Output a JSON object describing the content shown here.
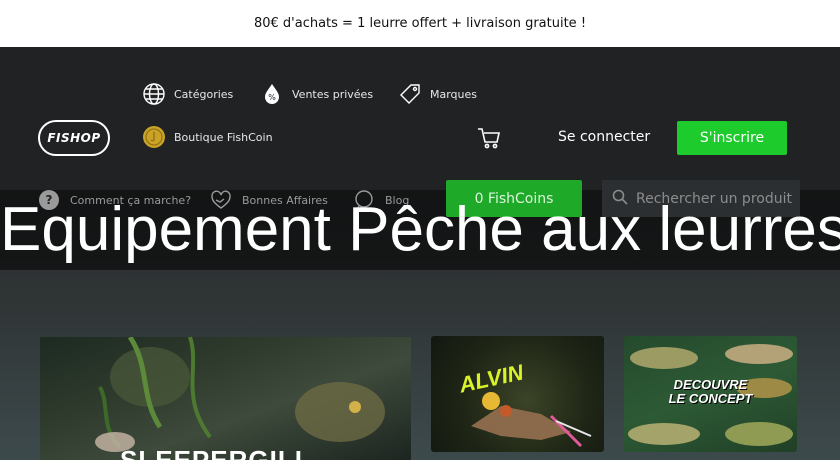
{
  "promo": {
    "text": "80€ d'achats = 1 leurre offert + livraison gratuite !"
  },
  "header": {
    "logo_text": "FISHOP",
    "nav": {
      "categories": "Catégories",
      "private_sales": "Ventes privées",
      "brands": "Marques",
      "fishcoin_shop": "Boutique FishCoin"
    },
    "login_label": "Se connecter",
    "signup_label": "S'inscrire"
  },
  "subnav": {
    "how_it_works": "Comment ça marche?",
    "good_deals": "Bonnes Affaires",
    "blog": "Blog"
  },
  "fishcoins_label": "0 FishCoins",
  "search": {
    "placeholder": "Rechercher un produit"
  },
  "page_title": "Equipement Pêche aux leurres",
  "cards": [
    {
      "text": "SLEEPERGILL"
    },
    {
      "text": "ALVIN"
    },
    {
      "line1": "DECOUVRE",
      "line2": "LE CONCEPT"
    }
  ],
  "icons": {
    "globe": "globe-icon",
    "private_sales": "drop-percent-icon",
    "brands": "tag-icon",
    "fishcoin": "coin-icon",
    "cart": "cart-icon",
    "help": "question-icon",
    "deals": "handshake-heart-icon",
    "blog": "chat-icon",
    "search": "search-icon"
  },
  "colors": {
    "accent_green": "#1ecb2c",
    "header_bg": "#202224",
    "coin_gold": "#c9a227"
  }
}
